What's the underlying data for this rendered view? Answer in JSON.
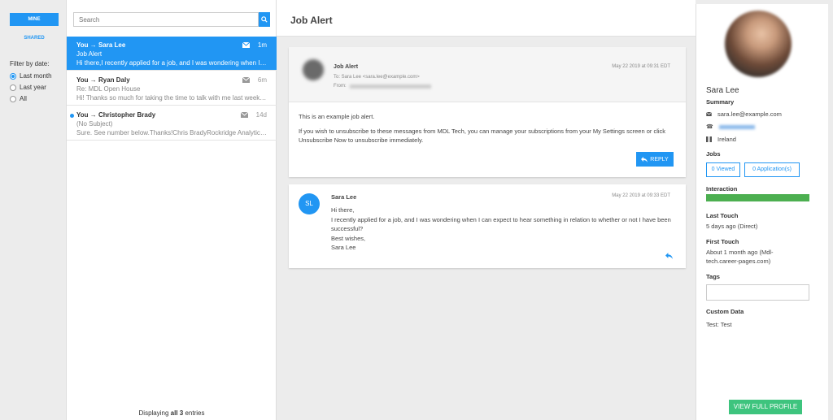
{
  "filters": {
    "mine_label": "MINE",
    "shared_label": "SHARED",
    "filter_by_date_label": "Filter by date:",
    "date_options": [
      {
        "label": "Last month",
        "checked": true
      },
      {
        "label": "Last year",
        "checked": false
      },
      {
        "label": "All",
        "checked": false
      }
    ]
  },
  "search": {
    "placeholder": "Search"
  },
  "conversations": [
    {
      "from": "You → Sara Lee",
      "time": "1m",
      "subject": "Job Alert",
      "preview": "Hi there,I recently applied for a job, and I was wondering when I can ...",
      "active": true,
      "unread": false
    },
    {
      "from": "You → Ryan Daly",
      "time": "6m",
      "subject": "Re: MDL Open House",
      "preview": "Hi! Thanks so much for taking the time to talk with me last week . . .",
      "active": false,
      "unread": false
    },
    {
      "from": "You → Christopher Brady",
      "time": "14d",
      "subject": "(No Subject)",
      "preview": "Sure. See number below.Thanks!Chris BradyRockridge Analytics, LL...",
      "active": false,
      "unread": true
    }
  ],
  "list_footer": {
    "prefix": "Displaying ",
    "bold": "all 3",
    "suffix": " entries"
  },
  "main": {
    "title": "Job Alert",
    "email": {
      "title": "Job Alert",
      "date": "May 22 2019 at 09:31 EDT",
      "to": "To: Sara Lee <sara.lee@example.com>",
      "from_label": "From:",
      "body_1": "This is an example job alert.",
      "body_2": "If you wish to unsubscribe to these messages from MDL Tech, you can manage your subscriptions from your My Settings screen or click Unsubscribe Now to unsubscribe immediately.",
      "reply_label": "REPLY"
    },
    "reply": {
      "initials": "SL",
      "name": "Sara Lee",
      "date": "May 22 2019 at 09:33 EDT",
      "line_1": "Hi there,",
      "line_2": "I recently applied for a job, and I was wondering when I can expect to hear something in relation to whether or not I have been successful?",
      "line_3": "Best wishes,",
      "line_4": "Sara Lee"
    }
  },
  "profile": {
    "name": "Sara Lee",
    "summary_label": "Summary",
    "email": "sara.lee@example.com",
    "location": "Ireland",
    "jobs_label": "Jobs",
    "viewed_label": "0 Viewed",
    "applications_label": "0 Application(s)",
    "interaction_label": "Interaction",
    "interaction_level": 1.0,
    "last_touch_label": "Last Touch",
    "last_touch_value": "5 days ago (Direct)",
    "first_touch_label": "First Touch",
    "first_touch_value": "About 1 month ago (Mdl-tech.career-pages.com)",
    "tags_label": "Tags",
    "custom_data_label": "Custom Data",
    "custom_data_value": "Test: Test",
    "view_profile_label": "VIEW FULL PROFILE"
  },
  "colors": {
    "accent": "#2196f3",
    "success": "#4caf50",
    "profile_button": "#3ec47e"
  }
}
